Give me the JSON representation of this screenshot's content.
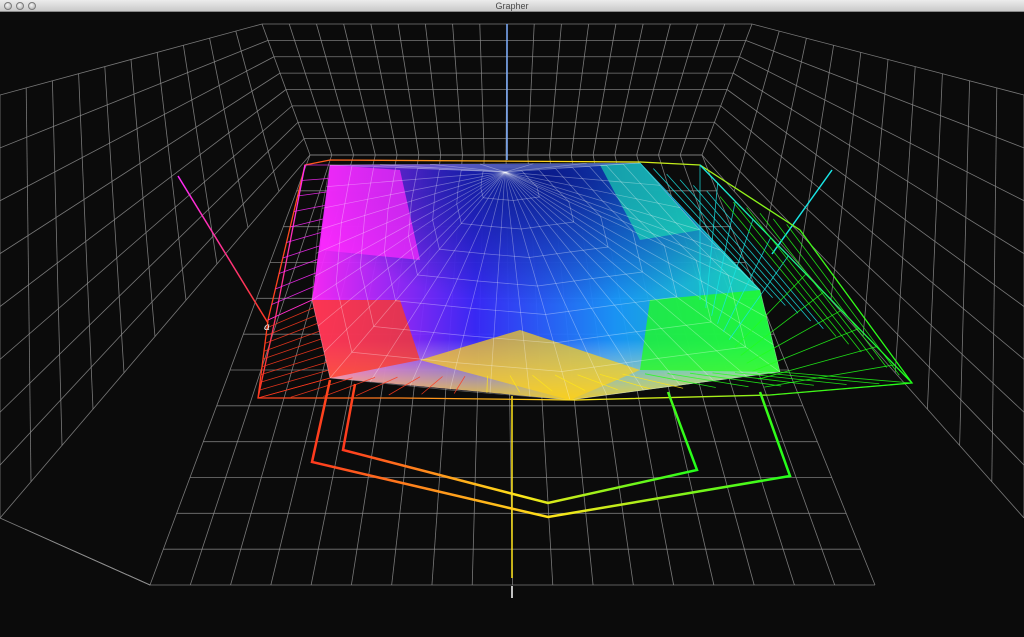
{
  "window": {
    "title": "Grapher"
  },
  "plot": {
    "axis_label": "a",
    "colors": {
      "background": "#0b0b0b",
      "grid": "#8c8c8c",
      "red": "#ff3a1e",
      "yellow": "#ffe51a",
      "green": "#22ff1a",
      "cyan": "#1ae6e6",
      "blue": "#1a2aff",
      "magenta": "#ff2aff",
      "white": "#ffffff"
    }
  }
}
